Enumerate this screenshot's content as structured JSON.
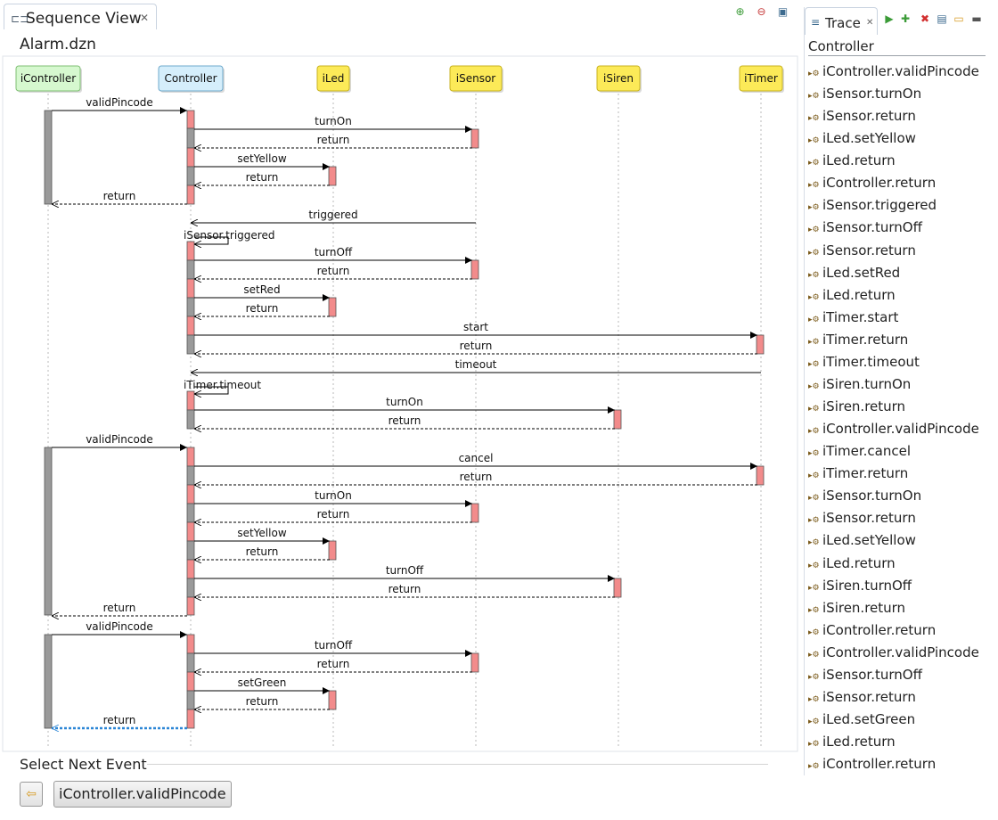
{
  "sequence_view": {
    "tab_label": "Sequence View",
    "file_title": "Alarm.dzn",
    "lifelines": [
      {
        "name": "iController",
        "color": "#d6f8cf",
        "border": "#7fbf73"
      },
      {
        "name": "Controller",
        "color": "#d5eefb",
        "border": "#6ea9cc"
      },
      {
        "name": "iLed",
        "color": "#fcea58",
        "border": "#c8b21e"
      },
      {
        "name": "iSensor",
        "color": "#fcea58",
        "border": "#c8b21e"
      },
      {
        "name": "iSiren",
        "color": "#fcea58",
        "border": "#c8b21e"
      },
      {
        "name": "iTimer",
        "color": "#fcea58",
        "border": "#c8b21e"
      }
    ],
    "messages": [
      {
        "label": "validPincode",
        "from": 0,
        "to": 1,
        "kind": "call"
      },
      {
        "label": "turnOn",
        "from": 1,
        "to": 3,
        "kind": "call"
      },
      {
        "label": "return",
        "from": 3,
        "to": 1,
        "kind": "return"
      },
      {
        "label": "setYellow",
        "from": 1,
        "to": 2,
        "kind": "call"
      },
      {
        "label": "return",
        "from": 2,
        "to": 1,
        "kind": "return"
      },
      {
        "label": "return",
        "from": 1,
        "to": 0,
        "kind": "return"
      },
      {
        "label": "triggered",
        "from": 3,
        "to": 1,
        "kind": "async"
      },
      {
        "label": "iSensor.triggered",
        "from": 1,
        "to": 1,
        "kind": "self"
      },
      {
        "label": "turnOff",
        "from": 1,
        "to": 3,
        "kind": "call"
      },
      {
        "label": "return",
        "from": 3,
        "to": 1,
        "kind": "return"
      },
      {
        "label": "setRed",
        "from": 1,
        "to": 2,
        "kind": "call"
      },
      {
        "label": "return",
        "from": 2,
        "to": 1,
        "kind": "return"
      },
      {
        "label": "start",
        "from": 1,
        "to": 5,
        "kind": "call"
      },
      {
        "label": "return",
        "from": 5,
        "to": 1,
        "kind": "return"
      },
      {
        "label": "timeout",
        "from": 5,
        "to": 1,
        "kind": "async"
      },
      {
        "label": "iTimer.timeout",
        "from": 1,
        "to": 1,
        "kind": "self"
      },
      {
        "label": "turnOn",
        "from": 1,
        "to": 4,
        "kind": "call"
      },
      {
        "label": "return",
        "from": 4,
        "to": 1,
        "kind": "return"
      },
      {
        "label": "validPincode",
        "from": 0,
        "to": 1,
        "kind": "call"
      },
      {
        "label": "cancel",
        "from": 1,
        "to": 5,
        "kind": "call"
      },
      {
        "label": "return",
        "from": 5,
        "to": 1,
        "kind": "return"
      },
      {
        "label": "turnOn",
        "from": 1,
        "to": 3,
        "kind": "call"
      },
      {
        "label": "return",
        "from": 3,
        "to": 1,
        "kind": "return"
      },
      {
        "label": "setYellow",
        "from": 1,
        "to": 2,
        "kind": "call"
      },
      {
        "label": "return",
        "from": 2,
        "to": 1,
        "kind": "return"
      },
      {
        "label": "turnOff",
        "from": 1,
        "to": 4,
        "kind": "call"
      },
      {
        "label": "return",
        "from": 4,
        "to": 1,
        "kind": "return"
      },
      {
        "label": "return",
        "from": 1,
        "to": 0,
        "kind": "return"
      },
      {
        "label": "validPincode",
        "from": 0,
        "to": 1,
        "kind": "call"
      },
      {
        "label": "turnOff",
        "from": 1,
        "to": 3,
        "kind": "call"
      },
      {
        "label": "return",
        "from": 3,
        "to": 1,
        "kind": "return"
      },
      {
        "label": "setGreen",
        "from": 1,
        "to": 2,
        "kind": "call"
      },
      {
        "label": "return",
        "from": 2,
        "to": 1,
        "kind": "return"
      },
      {
        "label": "return",
        "from": 1,
        "to": 0,
        "kind": "return",
        "highlighted": true
      }
    ]
  },
  "trace": {
    "tab_label": "Trace",
    "title": "Controller",
    "items": [
      "iController.validPincode",
      "iSensor.turnOn",
      "iSensor.return",
      "iLed.setYellow",
      "iLed.return",
      "iController.return",
      "iSensor.triggered",
      "iSensor.turnOff",
      "iSensor.return",
      "iLed.setRed",
      "iLed.return",
      "iTimer.start",
      "iTimer.return",
      "iTimer.timeout",
      "iSiren.turnOn",
      "iSiren.return",
      "iController.validPincode",
      "iTimer.cancel",
      "iTimer.return",
      "iSensor.turnOn",
      "iSensor.return",
      "iLed.setYellow",
      "iLed.return",
      "iSiren.turnOff",
      "iSiren.return",
      "iController.return",
      "iController.validPincode",
      "iSensor.turnOff",
      "iSensor.return",
      "iLed.setGreen",
      "iLed.return",
      "iController.return"
    ]
  },
  "next_event": {
    "label": "Select Next Event",
    "button_label": "iController.validPincode"
  },
  "colors": {
    "activation_red": "#f28b8b",
    "activation_gray": "#9a9a9a",
    "highlight_return": "#2b86d6"
  }
}
